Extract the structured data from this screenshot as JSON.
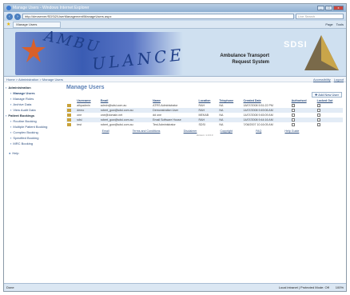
{
  "window": {
    "title": "Manage Users - Windows Internet Explorer",
    "address": "http://devserver/SDSi2/UserManagement/ManageUsers.aspx",
    "search_placeholder": "Live Search",
    "tab_label": "Manage Users",
    "toolbar_items": [
      "Page",
      "Tools"
    ]
  },
  "banner": {
    "app_title_line1": "Ambulance Transport",
    "app_title_line2": "Request System",
    "logo_text": "SDSI"
  },
  "breadcrumb": {
    "path": "Home > Administration > Manage Users",
    "right_links": [
      "Accessibility",
      "Logout"
    ]
  },
  "sidebar": {
    "groups": [
      {
        "label": "Administration",
        "items": [
          "Manage Users",
          "Manage Roles",
          "Archive Data",
          "View Audit Data"
        ]
      },
      {
        "label": "Patient Bookings",
        "items": [
          "Routine Booking",
          "Multiple Patient Booking",
          "Complex Booking",
          "Specified Booking",
          "MRC Booking"
        ]
      }
    ],
    "help_label": "Help"
  },
  "main": {
    "page_title": "Manage Users",
    "add_button": "Add New User",
    "columns": [
      "Username",
      "Email",
      "Name",
      "Location",
      "Telephone",
      "Created Date",
      "Authorised",
      "Locked Out"
    ],
    "rows": [
      [
        "aihpadmin",
        "admin@sdsi.com.au",
        "ATRS Administrator",
        "RAH",
        "NA",
        "18/07/2008 5:51:22 PM"
      ],
      [
        "demo",
        "robert_gow@sdsi.com.au",
        "Demonstration User",
        "RAH",
        "NA",
        "14/07/2008 9:49:06 AM"
      ],
      [
        "one",
        "one@domain.net",
        "dd one",
        "MEKAB",
        "NA",
        "14/07/2008 9:45:09 AM"
      ],
      [
        "sdsi",
        "robert_gow@sdsi.com.au",
        "Email Software House",
        "RAH",
        "NA",
        "14/07/2008 9:44:16 AM"
      ],
      [
        "test",
        "robert_gow@sdsi.com.au",
        "Test Administrator",
        "SDSI",
        "NA",
        "7/08/2007 10:16:05 AM"
      ]
    ],
    "filter_links": [
      "Email",
      "Terms and Conditions",
      "Disclaimer",
      "Copyright",
      "FAQ",
      "Help Guide"
    ],
    "footer_note": "Version: 1.0.0.0"
  },
  "statusbar": {
    "left": "Done",
    "zone": "Local intranet | Protected Mode: Off",
    "zoom": "100%"
  }
}
